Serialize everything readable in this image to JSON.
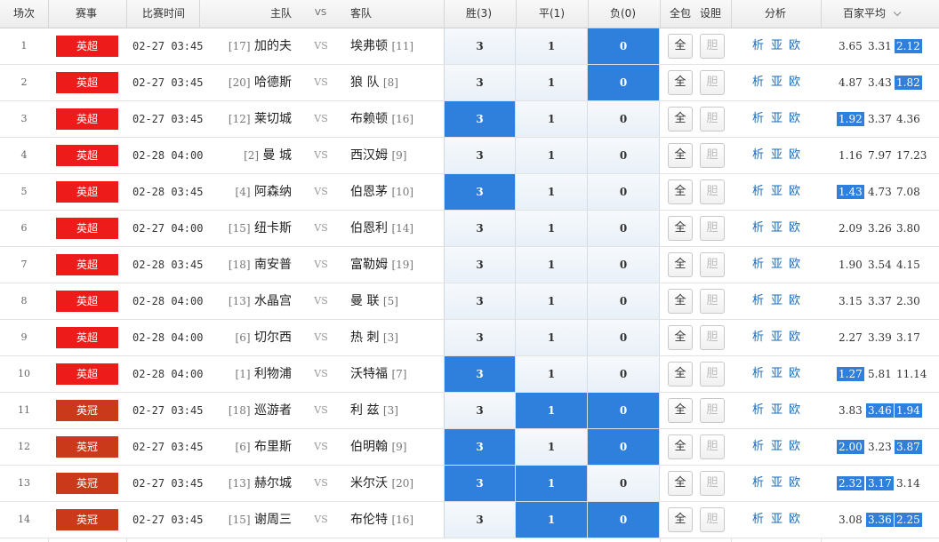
{
  "headers": {
    "idx": "场次",
    "league": "赛事",
    "time": "比赛时间",
    "home": "主队",
    "vs": "VS",
    "away": "客队",
    "win": "胜(3)",
    "draw": "平(1)",
    "loss": "负(0)",
    "all": "全包",
    "dan": "设胆",
    "analysis": "分析",
    "avg": "百家平均"
  },
  "labels": {
    "all_btn": "全",
    "dan_btn": "胆",
    "xi": "析",
    "ya": "亚",
    "ou": "欧",
    "vs": "VS"
  },
  "colors": {
    "premier": "#ee1b1b",
    "championship": "#c9391a",
    "selected": "#2f7fdc",
    "link": "#1a6bb8"
  },
  "matches": [
    {
      "idx": "1",
      "league": "英超",
      "time": "02-27 03:45",
      "home_rank": "[17]",
      "home": "加的夫",
      "away": "埃弗顿",
      "away_rank": "[11]",
      "odds": [
        "3",
        "1",
        "0"
      ],
      "sel": [
        false,
        false,
        true
      ],
      "avg": [
        "3.65",
        "3.31",
        "2.12"
      ],
      "avg_hl": [
        false,
        false,
        true
      ]
    },
    {
      "idx": "2",
      "league": "英超",
      "time": "02-27 03:45",
      "home_rank": "[20]",
      "home": "哈德斯",
      "away": "狼 队",
      "away_rank": "[8]",
      "odds": [
        "3",
        "1",
        "0"
      ],
      "sel": [
        false,
        false,
        true
      ],
      "avg": [
        "4.87",
        "3.43",
        "1.82"
      ],
      "avg_hl": [
        false,
        false,
        true
      ]
    },
    {
      "idx": "3",
      "league": "英超",
      "time": "02-27 03:45",
      "home_rank": "[12]",
      "home": "莱切城",
      "away": "布赖顿",
      "away_rank": "[16]",
      "odds": [
        "3",
        "1",
        "0"
      ],
      "sel": [
        true,
        false,
        false
      ],
      "avg": [
        "1.92",
        "3.37",
        "4.36"
      ],
      "avg_hl": [
        true,
        false,
        false
      ]
    },
    {
      "idx": "4",
      "league": "英超",
      "time": "02-28 04:00",
      "home_rank": "[2]",
      "home": "曼 城",
      "away": "西汉姆",
      "away_rank": "[9]",
      "odds": [
        "3",
        "1",
        "0"
      ],
      "sel": [
        false,
        false,
        false
      ],
      "avg": [
        "1.16",
        "7.97",
        "17.23"
      ],
      "avg_hl": [
        false,
        false,
        false
      ]
    },
    {
      "idx": "5",
      "league": "英超",
      "time": "02-28 03:45",
      "home_rank": "[4]",
      "home": "阿森纳",
      "away": "伯恩茅",
      "away_rank": "[10]",
      "odds": [
        "3",
        "1",
        "0"
      ],
      "sel": [
        true,
        false,
        false
      ],
      "avg": [
        "1.43",
        "4.73",
        "7.08"
      ],
      "avg_hl": [
        true,
        false,
        false
      ]
    },
    {
      "idx": "6",
      "league": "英超",
      "time": "02-27 04:00",
      "home_rank": "[15]",
      "home": "纽卡斯",
      "away": "伯恩利",
      "away_rank": "[14]",
      "odds": [
        "3",
        "1",
        "0"
      ],
      "sel": [
        false,
        false,
        false
      ],
      "avg": [
        "2.09",
        "3.26",
        "3.80"
      ],
      "avg_hl": [
        false,
        false,
        false
      ]
    },
    {
      "idx": "7",
      "league": "英超",
      "time": "02-28 03:45",
      "home_rank": "[18]",
      "home": "南安普",
      "away": "富勒姆",
      "away_rank": "[19]",
      "odds": [
        "3",
        "1",
        "0"
      ],
      "sel": [
        false,
        false,
        false
      ],
      "avg": [
        "1.90",
        "3.54",
        "4.15"
      ],
      "avg_hl": [
        false,
        false,
        false
      ]
    },
    {
      "idx": "8",
      "league": "英超",
      "time": "02-28 04:00",
      "home_rank": "[13]",
      "home": "水晶宫",
      "away": "曼 联",
      "away_rank": "[5]",
      "odds": [
        "3",
        "1",
        "0"
      ],
      "sel": [
        false,
        false,
        false
      ],
      "avg": [
        "3.15",
        "3.37",
        "2.30"
      ],
      "avg_hl": [
        false,
        false,
        false
      ]
    },
    {
      "idx": "9",
      "league": "英超",
      "time": "02-28 04:00",
      "home_rank": "[6]",
      "home": "切尔西",
      "away": "热 刺",
      "away_rank": "[3]",
      "odds": [
        "3",
        "1",
        "0"
      ],
      "sel": [
        false,
        false,
        false
      ],
      "avg": [
        "2.27",
        "3.39",
        "3.17"
      ],
      "avg_hl": [
        false,
        false,
        false
      ]
    },
    {
      "idx": "10",
      "league": "英超",
      "time": "02-28 04:00",
      "home_rank": "[1]",
      "home": "利物浦",
      "away": "沃特福",
      "away_rank": "[7]",
      "odds": [
        "3",
        "1",
        "0"
      ],
      "sel": [
        true,
        false,
        false
      ],
      "avg": [
        "1.27",
        "5.81",
        "11.14"
      ],
      "avg_hl": [
        true,
        false,
        false
      ]
    },
    {
      "idx": "11",
      "league": "英冠",
      "time": "02-27 03:45",
      "home_rank": "[18]",
      "home": "巡游者",
      "away": "利 兹",
      "away_rank": "[3]",
      "odds": [
        "3",
        "1",
        "0"
      ],
      "sel": [
        false,
        true,
        true
      ],
      "avg": [
        "3.83",
        "3.46",
        "1.94"
      ],
      "avg_hl": [
        false,
        true,
        true
      ]
    },
    {
      "idx": "12",
      "league": "英冠",
      "time": "02-27 03:45",
      "home_rank": "[6]",
      "home": "布里斯",
      "away": "伯明翰",
      "away_rank": "[9]",
      "odds": [
        "3",
        "1",
        "0"
      ],
      "sel": [
        true,
        false,
        true
      ],
      "avg": [
        "2.00",
        "3.23",
        "3.87"
      ],
      "avg_hl": [
        true,
        false,
        true
      ]
    },
    {
      "idx": "13",
      "league": "英冠",
      "time": "02-27 03:45",
      "home_rank": "[13]",
      "home": "赫尔城",
      "away": "米尔沃",
      "away_rank": "[20]",
      "odds": [
        "3",
        "1",
        "0"
      ],
      "sel": [
        true,
        true,
        false
      ],
      "avg": [
        "2.32",
        "3.17",
        "3.14"
      ],
      "avg_hl": [
        true,
        true,
        false
      ]
    },
    {
      "idx": "14",
      "league": "英冠",
      "time": "02-27 03:45",
      "home_rank": "[15]",
      "home": "谢周三",
      "away": "布伦特",
      "away_rank": "[16]",
      "odds": [
        "3",
        "1",
        "0"
      ],
      "sel": [
        false,
        true,
        true
      ],
      "avg": [
        "3.08",
        "3.36",
        "2.25"
      ],
      "avg_hl": [
        false,
        true,
        true
      ]
    }
  ]
}
